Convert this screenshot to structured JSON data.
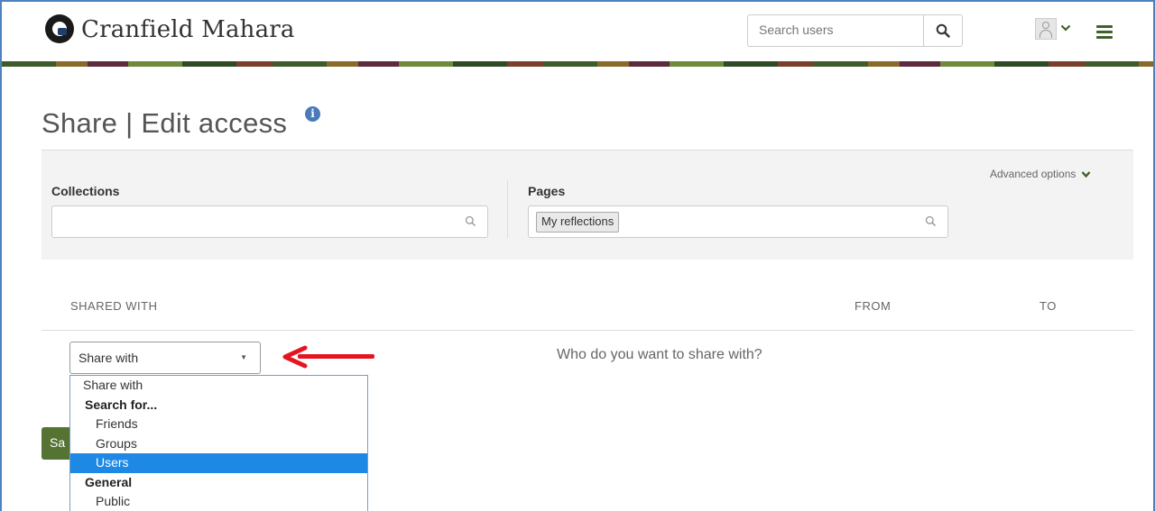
{
  "header": {
    "site_title": "Cranfield Mahara",
    "search_placeholder": "Search users",
    "search_icon": "search-icon",
    "user_icon": "user-avatar-icon",
    "menu_icon": "hamburger-menu-icon"
  },
  "page": {
    "title": "Share | Edit access",
    "info_icon": "info-icon"
  },
  "filters": {
    "advanced_options": "Advanced options",
    "collections_label": "Collections",
    "collections_value": "",
    "pages_label": "Pages",
    "pages_tags": [
      "My reflections"
    ]
  },
  "table": {
    "headers": [
      "SHARED WITH",
      "FROM",
      "TO"
    ]
  },
  "share_select": {
    "selected": "Share with",
    "prompt": "Who do you want to share with?",
    "options": [
      {
        "label": "Share with",
        "kind": "option"
      },
      {
        "label": "Search for...",
        "kind": "group"
      },
      {
        "label": "Friends",
        "kind": "child"
      },
      {
        "label": "Groups",
        "kind": "child"
      },
      {
        "label": "Users",
        "kind": "child",
        "selected": true
      },
      {
        "label": "General",
        "kind": "group"
      },
      {
        "label": "Public",
        "kind": "child"
      }
    ]
  },
  "actions": {
    "save_label": "Sa"
  },
  "colors": {
    "accent_green": "#557433",
    "selected_blue": "#1e88e5",
    "arrow_red": "#e5141e"
  }
}
